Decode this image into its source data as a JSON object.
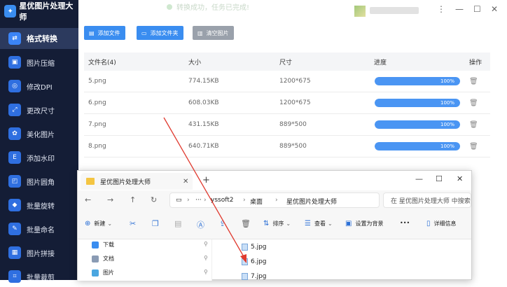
{
  "app": {
    "title": "星优图片处理大师"
  },
  "sidebar": {
    "items": [
      {
        "label": "格式转换",
        "icon": "format-convert-icon",
        "active": true
      },
      {
        "label": "图片压缩",
        "icon": "compress-icon"
      },
      {
        "label": "修改DPI",
        "icon": "dpi-icon"
      },
      {
        "label": "更改尺寸",
        "icon": "resize-icon"
      },
      {
        "label": "美化图片",
        "icon": "beautify-icon"
      },
      {
        "label": "添加水印",
        "icon": "watermark-icon"
      },
      {
        "label": "图片圆角",
        "icon": "rounded-corner-icon"
      },
      {
        "label": "批量旋转",
        "icon": "rotate-icon"
      },
      {
        "label": "批量命名",
        "icon": "rename-icon"
      },
      {
        "label": "图片拼接",
        "icon": "stitch-icon"
      },
      {
        "label": "批量裁剪",
        "icon": "crop-icon"
      }
    ]
  },
  "toast": {
    "text": "转换成功，任务已完成!"
  },
  "toolbar": {
    "add_file": "添加文件",
    "add_folder": "添加文件夹",
    "clear": "清空图片"
  },
  "table": {
    "headers": {
      "name": "文件名(4)",
      "size": "大小",
      "dimensions": "尺寸",
      "progress": "进度",
      "action": "操作"
    },
    "rows": [
      {
        "name": "5.png",
        "size": "774.15KB",
        "dimensions": "1200*675",
        "progress": "100%"
      },
      {
        "name": "6.png",
        "size": "608.03KB",
        "dimensions": "1200*675",
        "progress": "100%"
      },
      {
        "name": "7.png",
        "size": "431.15KB",
        "dimensions": "889*500",
        "progress": "100%"
      },
      {
        "name": "8.png",
        "size": "640.71KB",
        "dimensions": "889*500",
        "progress": "100%"
      }
    ]
  },
  "explorer": {
    "tab_title": "星优图片处理大师",
    "breadcrumb": [
      "yssoft2",
      "桌面",
      "星优图片处理大师"
    ],
    "search_placeholder": "在 星优图片处理大师 中搜索",
    "commands": {
      "new": "新建",
      "sort": "排序",
      "view": "查看",
      "set_background": "设置为背景",
      "more": "•••",
      "details": "详细信息"
    },
    "quick_access": [
      {
        "label": "下载"
      },
      {
        "label": "文档"
      },
      {
        "label": "图片"
      }
    ],
    "files": [
      "5.jpg",
      "6.jpg",
      "7.jpg"
    ]
  },
  "colors": {
    "sidebar_bg": "#141d36",
    "accent": "#3a8df0",
    "progress": "#4a95f3",
    "arrow": "#e03a2f"
  }
}
